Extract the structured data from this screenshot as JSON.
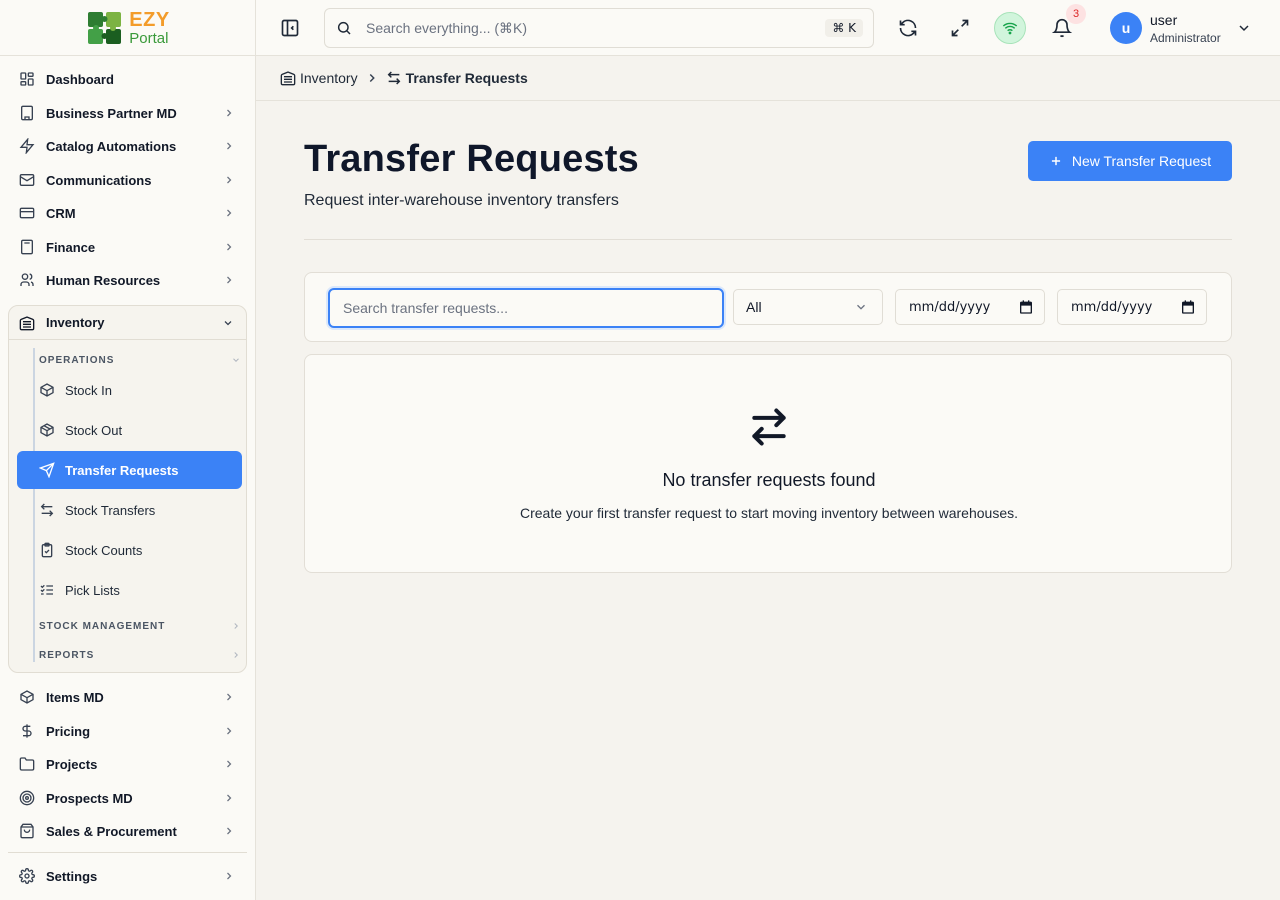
{
  "app": {
    "logo_main": "EZY",
    "logo_sub": "Portal"
  },
  "sidebar": {
    "top_items": [
      {
        "label": "Dashboard",
        "icon": "dashboard-icon"
      },
      {
        "label": "Business Partner MD",
        "icon": "building-icon"
      },
      {
        "label": "Catalog Automations",
        "icon": "lightning-icon"
      },
      {
        "label": "Communications",
        "icon": "mail-icon"
      },
      {
        "label": "CRM",
        "icon": "credit-card-icon"
      },
      {
        "label": "Finance",
        "icon": "calculator-icon"
      },
      {
        "label": "Human Resources",
        "icon": "users-icon"
      }
    ],
    "inventory": {
      "label": "Inventory",
      "sections": {
        "operations": "OPERATIONS",
        "stock_management": "STOCK MANAGEMENT",
        "reports": "REPORTS"
      },
      "items": [
        {
          "label": "Stock In",
          "icon": "package-in-icon"
        },
        {
          "label": "Stock Out",
          "icon": "package-out-icon"
        },
        {
          "label": "Transfer Requests",
          "icon": "send-icon",
          "active": true
        },
        {
          "label": "Stock Transfers",
          "icon": "swap-arrows-icon"
        },
        {
          "label": "Stock Counts",
          "icon": "clipboard-check-icon"
        },
        {
          "label": "Pick Lists",
          "icon": "checklist-icon"
        }
      ]
    },
    "bottom_items": [
      {
        "label": "Items MD",
        "icon": "box-icon"
      },
      {
        "label": "Pricing",
        "icon": "dollar-icon"
      },
      {
        "label": "Projects",
        "icon": "folder-icon"
      },
      {
        "label": "Prospects MD",
        "icon": "target-icon"
      },
      {
        "label": "Sales & Procurement",
        "icon": "cart-icon"
      }
    ],
    "settings": {
      "label": "Settings",
      "icon": "gear-icon"
    }
  },
  "topbar": {
    "search_placeholder": "Search everything... (⌘K)",
    "shortcut": "⌘ K",
    "notification_count": "3",
    "user": {
      "initial": "u",
      "name": "user",
      "role": "Administrator"
    }
  },
  "breadcrumb": {
    "parent": "Inventory",
    "current": "Transfer Requests"
  },
  "page": {
    "title": "Transfer Requests",
    "subtitle": "Request inter-warehouse inventory transfers",
    "new_button": "New Transfer Request"
  },
  "filters": {
    "search_placeholder": "Search transfer requests...",
    "status_value": "All",
    "date_from": "mm/dd/yyyy",
    "date_to": "mm/dd/yyyy"
  },
  "empty_state": {
    "title": "No transfer requests found",
    "description": "Create your first transfer request to start moving inventory between warehouses."
  },
  "colors": {
    "accent": "#3b82f6",
    "background": "#f5f3ee",
    "surface": "#fbfaf6",
    "online": "#16a34a",
    "badge": "#dc2626"
  }
}
